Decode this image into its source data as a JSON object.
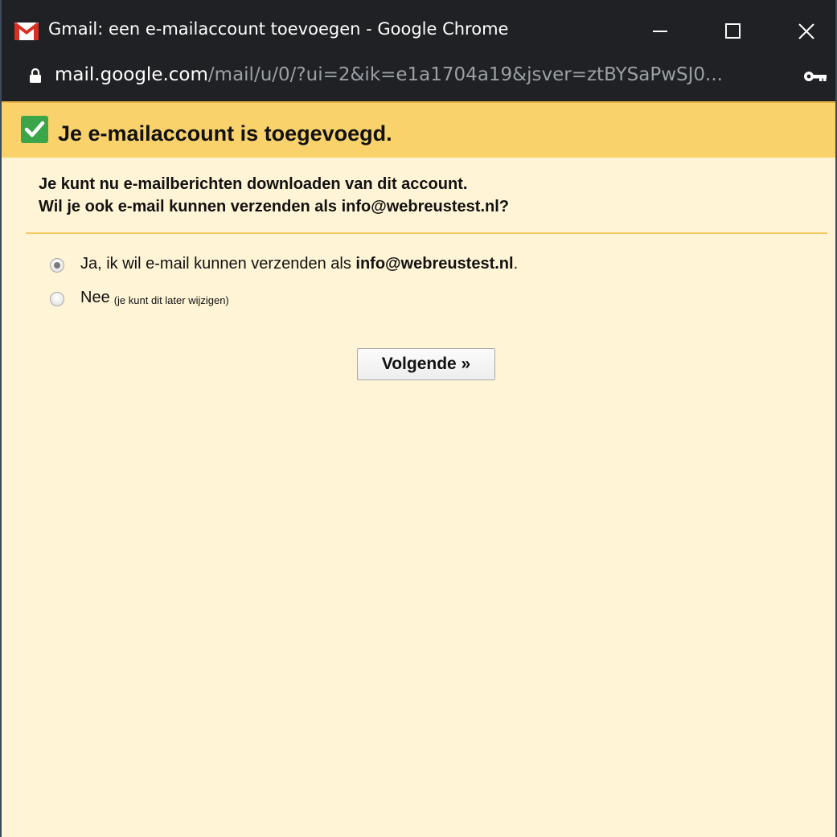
{
  "window": {
    "title": "Gmail: een e-mailaccount toevoegen - Google Chrome",
    "icon": "gmail-icon",
    "controls": [
      "minimize-icon",
      "maximize-icon",
      "close-icon"
    ]
  },
  "address_bar": {
    "host": "mail.google.com",
    "path": "/mail/u/0/?ui=2&ik=e1a1704a19&jsver=ztBYSaPwSJ0...",
    "left_icon": "lock-icon",
    "right_icon": "key-icon"
  },
  "banner": {
    "icon": "check-icon",
    "title": "Je e-mailaccount is toegevoegd."
  },
  "intro": {
    "line1": "Je kunt nu e-mailberichten downloaden van dit account.",
    "line2": "Wil je ook e-mail kunnen verzenden als info@webreustest.nl?"
  },
  "options": {
    "yes": {
      "label_prefix": "Ja, ik wil e-mail kunnen verzenden als ",
      "label_email": "info@webreustest.nl",
      "label_suffix": ".",
      "checked": true
    },
    "no": {
      "label": "Nee",
      "note": "(je kunt dit later wijzigen)",
      "checked": false
    }
  },
  "next_button": {
    "label": "Volgende »"
  },
  "colors": {
    "titlebar": "#202124",
    "banner": "#f9d26b",
    "background": "#fff4d6",
    "check": "#3ba54a",
    "divider": "#f5c862"
  }
}
